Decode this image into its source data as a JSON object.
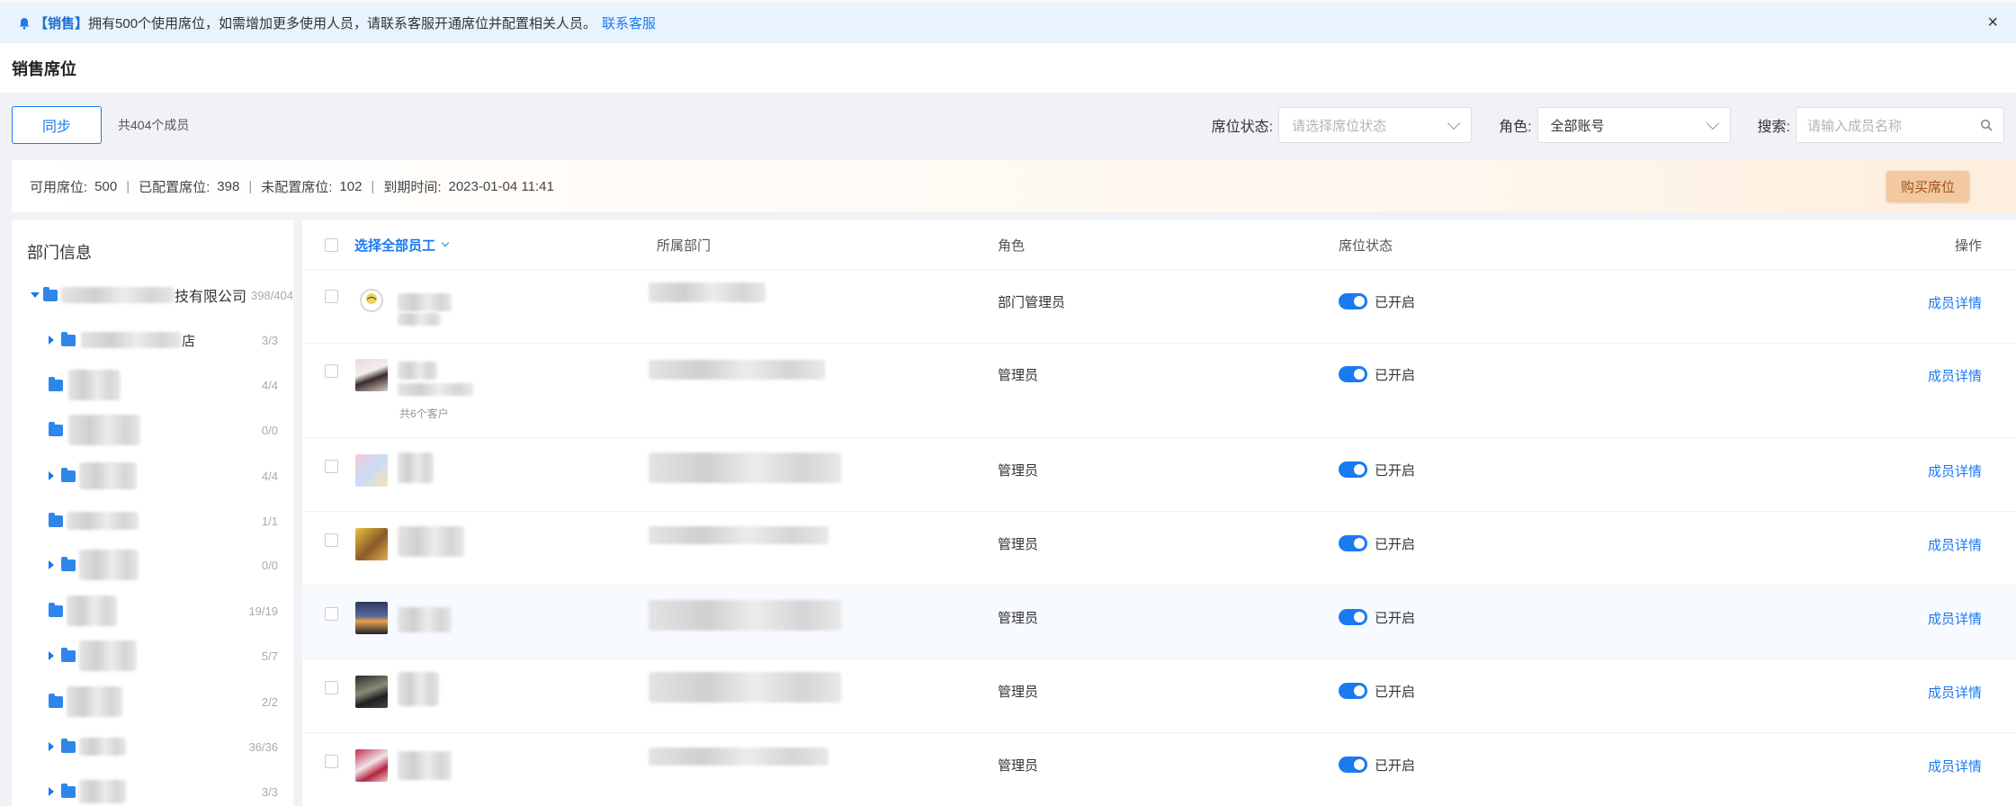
{
  "notice": {
    "tag": "【销售】",
    "text": "拥有500个使用席位，如需增加更多使用人员，请联系客服开通席位并配置相关人员。",
    "link": "联系客服",
    "close": "×"
  },
  "page_title": "销售席位",
  "toolbar": {
    "sync_label": "同步",
    "member_count": "共404个成员",
    "seat_status_label": "席位状态:",
    "seat_status_placeholder": "请选择席位状态",
    "role_label": "角色:",
    "role_value": "全部账号",
    "search_label": "搜索:",
    "search_placeholder": "请输入成员名称"
  },
  "seat_info": {
    "available_label": "可用席位:",
    "available_value": "500",
    "configured_label": "已配置席位:",
    "configured_value": "398",
    "unconfigured_label": "未配置席位:",
    "unconfigured_value": "102",
    "expire_label": "到期时间:",
    "expire_value": "2023-01-04 11:41",
    "buy_label": "购买席位"
  },
  "sidebar": {
    "title": "部门信息",
    "root": {
      "name_suffix": "技有限公司",
      "count": "398/404"
    },
    "items": [
      {
        "suffix": "店",
        "count": "3/3",
        "caret": true
      },
      {
        "suffix": "",
        "count": "4/4",
        "caret": false
      },
      {
        "suffix": "",
        "count": "0/0",
        "caret": false
      },
      {
        "suffix": "",
        "count": "4/4",
        "caret": true
      },
      {
        "suffix": "",
        "count": "1/1",
        "caret": false
      },
      {
        "suffix": "",
        "count": "0/0",
        "caret": true
      },
      {
        "suffix": "",
        "count": "19/19",
        "caret": false
      },
      {
        "suffix": "",
        "count": "5/7",
        "caret": true
      },
      {
        "suffix": "",
        "count": "2/2",
        "caret": false
      },
      {
        "suffix": "",
        "count": "36/36",
        "caret": true
      },
      {
        "suffix": "",
        "count": "3/3",
        "caret": true
      }
    ]
  },
  "table": {
    "headers": {
      "select_all": "选择全部员工",
      "department": "所属部门",
      "role": "角色",
      "seat_status": "席位状态",
      "operation": "操作"
    },
    "rows": [
      {
        "role": "部门管理员",
        "status": "已开启",
        "action": "成员详情",
        "clients": ""
      },
      {
        "role": "管理员",
        "status": "已开启",
        "action": "成员详情",
        "clients": "共6个客户"
      },
      {
        "role": "管理员",
        "status": "已开启",
        "action": "成员详情",
        "clients": ""
      },
      {
        "role": "管理员",
        "status": "已开启",
        "action": "成员详情",
        "clients": ""
      },
      {
        "role": "管理员",
        "status": "已开启",
        "action": "成员详情",
        "clients": ""
      },
      {
        "role": "管理员",
        "status": "已开启",
        "action": "成员详情",
        "clients": ""
      },
      {
        "role": "管理员",
        "status": "已开启",
        "action": "成员详情",
        "clients": ""
      }
    ]
  },
  "colors": {
    "primary": "#1a7af0",
    "notice_bg": "#e9f3fd",
    "buy_bg": "#f2c9a0",
    "buy_text": "#a0521a"
  }
}
